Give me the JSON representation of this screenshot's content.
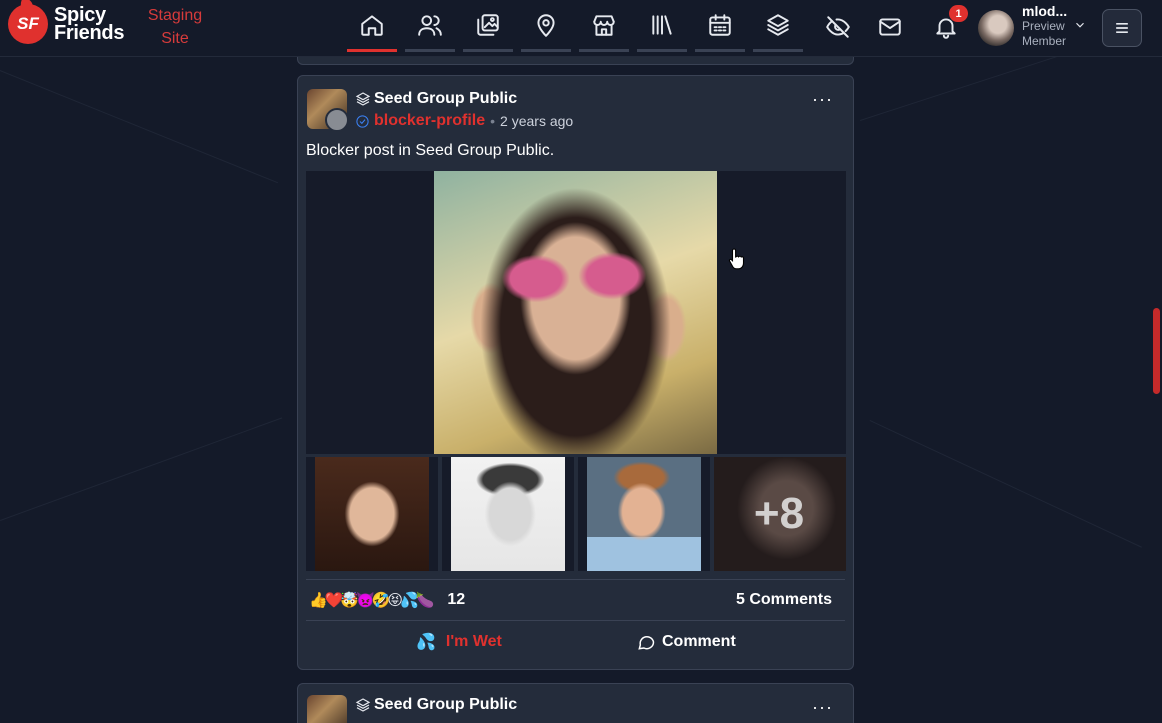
{
  "brand": {
    "badge": "SF",
    "name_line1": "Spicy",
    "name_line2": "Friends",
    "env_label": "Staging Site"
  },
  "nav": {
    "items": [
      {
        "name": "home",
        "icon": "home-icon",
        "active": true
      },
      {
        "name": "friends",
        "icon": "users-icon",
        "active": false
      },
      {
        "name": "photos",
        "icon": "gallery-icon",
        "active": false
      },
      {
        "name": "places",
        "icon": "map-pin-icon",
        "active": false
      },
      {
        "name": "store",
        "icon": "store-icon",
        "active": false
      },
      {
        "name": "library",
        "icon": "library-icon",
        "active": false
      },
      {
        "name": "events",
        "icon": "calendar-icon",
        "active": false
      },
      {
        "name": "groups",
        "icon": "layers-icon",
        "active": false
      }
    ],
    "hidden_icon": "eye-off-icon",
    "mail_icon": "mail-icon",
    "notifications_icon": "bell-icon",
    "notification_count": "1"
  },
  "user": {
    "name": "mlod...",
    "role_line1": "Preview",
    "role_line2": "Member"
  },
  "post": {
    "group": "Seed Group Public",
    "author": "blocker-profile",
    "time": "2 years ago",
    "more": "···",
    "text": "Blocker post in Seed Group Public.",
    "extra_photos": "+8",
    "reactions_emojis": "👍❤️🤯👿🤣😝💦🍆",
    "reactions_count": "12",
    "comments_label": "5 Comments",
    "action_reaction_label": "I'm Wet",
    "action_reaction_icon": "💦",
    "action_comment_label": "Comment"
  },
  "next_post": {
    "group": "Seed Group Public",
    "more": "···"
  }
}
